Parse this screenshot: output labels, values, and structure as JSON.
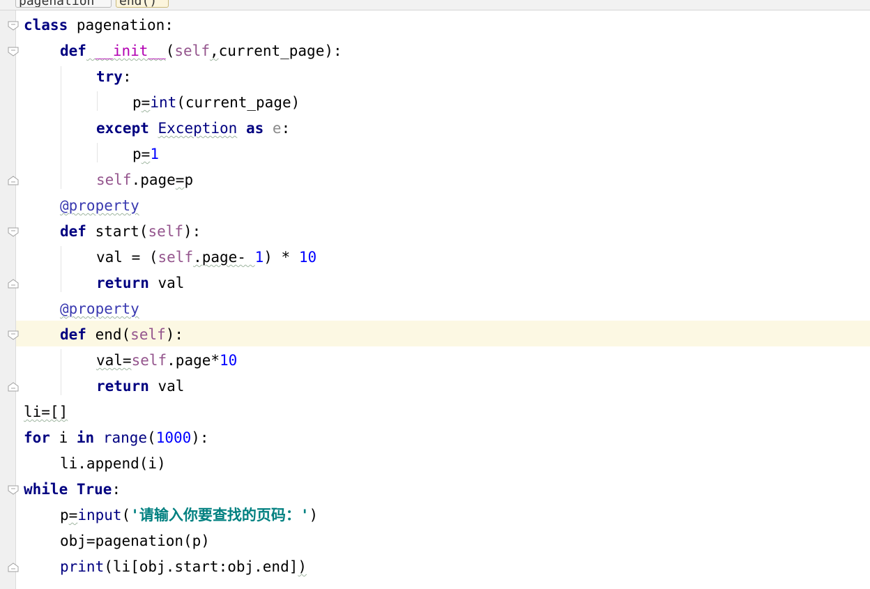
{
  "breadcrumb": {
    "item1": "pagenation",
    "item2": "end()"
  },
  "code": {
    "l1": {
      "kw": "class",
      "name": " pagenation",
      "colon": ":"
    },
    "l2": {
      "kw": "def",
      "name": " __init__",
      "open": "(",
      "self": "self",
      "comma": ",",
      "param": "current_page",
      "close": "):"
    },
    "l3": {
      "kw": "try",
      "colon": ":"
    },
    "l4": {
      "p": "p",
      "eq": "=",
      "fn": "int",
      "rest": "(current_page)"
    },
    "l5": {
      "kw": "except",
      "cls": "Exception",
      "as": "as",
      "e": "e",
      "colon": ":"
    },
    "l6": {
      "p": "p",
      "eq": "=",
      "num": "1"
    },
    "l7": {
      "self": "self",
      "rest": ".page",
      "eq": "=",
      "p": "p"
    },
    "l8": {
      "dec": "@property"
    },
    "l9": {
      "kw": "def",
      "name": " start",
      "open": "(",
      "self": "self",
      "close": "):"
    },
    "l10": {
      "a": "val = (",
      "self": "self",
      "b": ".page- ",
      "n1": "1",
      "c": ") * ",
      "n2": "10"
    },
    "l11": {
      "kw": "return",
      "rest": " val"
    },
    "l12": {
      "dec": "@property"
    },
    "l13": {
      "kw": "def",
      "name": " end",
      "open": "(",
      "self": "self",
      "close": "):"
    },
    "l14": {
      "a": "val=",
      "self": "self",
      "b": ".page*",
      "n": "10"
    },
    "l15": {
      "kw": "return",
      "rest": " val"
    },
    "l16": {
      "text": "li=[]"
    },
    "l17": {
      "kw1": "for",
      "a": " i ",
      "kw2": "in",
      "sp": " ",
      "fn": "range",
      "open": "(",
      "n": "1000",
      "close": "):"
    },
    "l18": {
      "text": "li.append(i)"
    },
    "l19": {
      "kw": "while",
      "sp": " ",
      "kw2": "True",
      "colon": ":"
    },
    "l20": {
      "p": "p",
      "eq": "=",
      "fn": "input",
      "open": "(",
      "str": "'请输入你要查找的页码：'",
      "close": ")"
    },
    "l21": {
      "text": "obj=pagenation(p)"
    },
    "l22": {
      "fn": "print",
      "rest": "(li[obj.start:obj.end]",
      "close": ")"
    }
  },
  "colors": {
    "keyword": "#000080",
    "self": "#94558d",
    "number": "#0000ff",
    "decorator": "#3a3ab0",
    "string": "#008080",
    "caret_line": "#fcf8e3"
  },
  "icons": [
    "fold-open-icon",
    "fold-close-icon"
  ]
}
